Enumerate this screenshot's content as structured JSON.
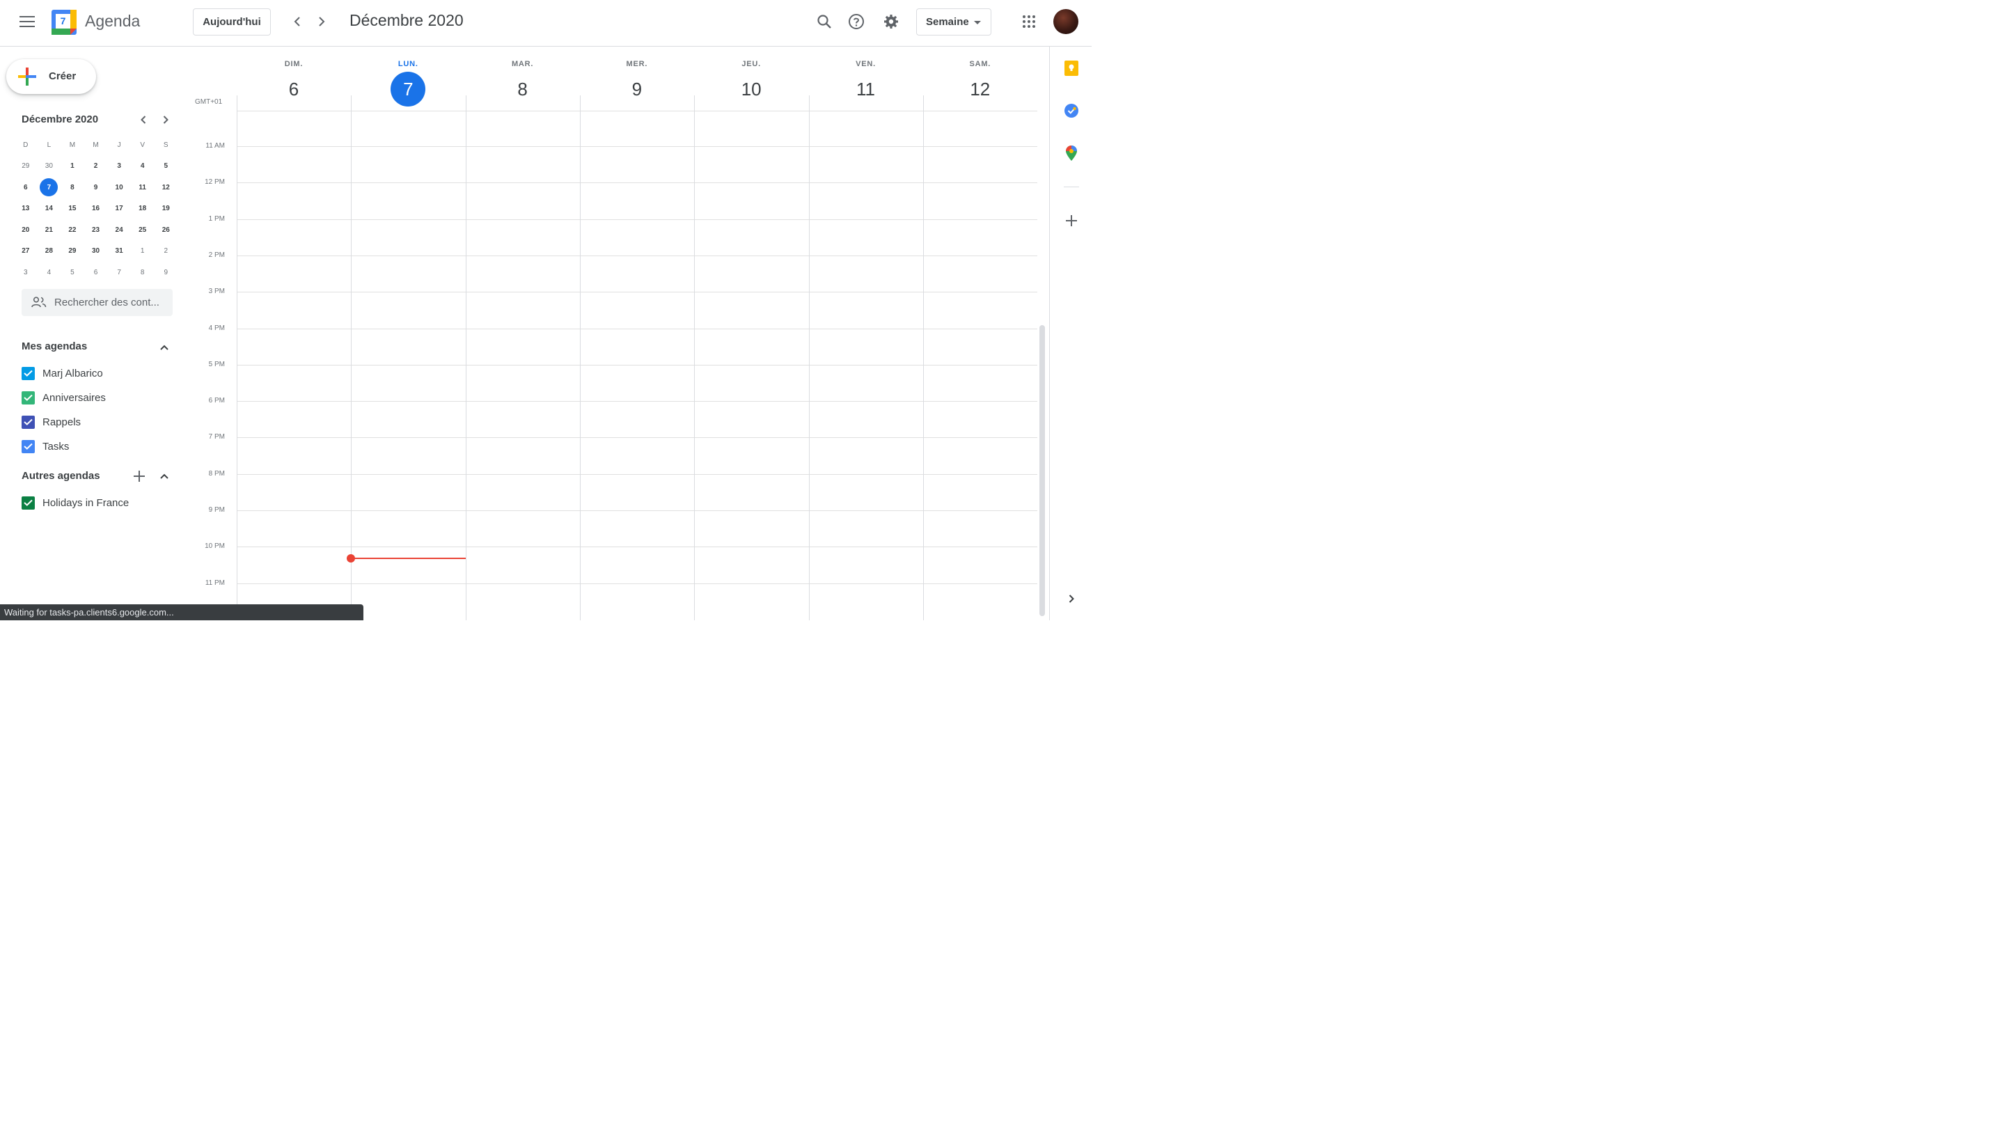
{
  "header": {
    "app_name": "Agenda",
    "logo_day": "7",
    "today_label": "Aujourd'hui",
    "period_title": "Décembre 2020",
    "view_label": "Semaine",
    "icons": [
      "menu-icon",
      "chevron-left-icon",
      "chevron-right-icon",
      "search-icon",
      "help-icon",
      "settings-icon",
      "apps-grid-icon"
    ]
  },
  "sidebar": {
    "create_label": "Créer",
    "mini_calendar": {
      "title": "Décembre 2020",
      "weekday_headers": [
        "D",
        "L",
        "M",
        "M",
        "J",
        "V",
        "S"
      ],
      "weeks": [
        [
          "29",
          "30",
          "1",
          "2",
          "3",
          "4",
          "5"
        ],
        [
          "6",
          "7",
          "8",
          "9",
          "10",
          "11",
          "12"
        ],
        [
          "13",
          "14",
          "15",
          "16",
          "17",
          "18",
          "19"
        ],
        [
          "20",
          "21",
          "22",
          "23",
          "24",
          "25",
          "26"
        ],
        [
          "27",
          "28",
          "29",
          "30",
          "31",
          "1",
          "2"
        ],
        [
          "3",
          "4",
          "5",
          "6",
          "7",
          "8",
          "9"
        ]
      ],
      "selected": "7"
    },
    "search_placeholder": "Rechercher des cont...",
    "my_calendars_title": "Mes agendas",
    "my_calendars": [
      {
        "name": "Marj Albarico",
        "color": "#039be5",
        "checked": true
      },
      {
        "name": "Anniversaires",
        "color": "#33b679",
        "checked": true
      },
      {
        "name": "Rappels",
        "color": "#3f51b5",
        "checked": true
      },
      {
        "name": "Tasks",
        "color": "#4285f4",
        "checked": true
      }
    ],
    "other_calendars_title": "Autres agendas",
    "other_calendars": [
      {
        "name": "Holidays in France",
        "color": "#0b8043",
        "checked": true
      }
    ]
  },
  "week": {
    "timezone": "GMT+01",
    "days": [
      {
        "dow": "DIM.",
        "num": "6",
        "today": false
      },
      {
        "dow": "LUN.",
        "num": "7",
        "today": true
      },
      {
        "dow": "MAR.",
        "num": "8",
        "today": false
      },
      {
        "dow": "MER.",
        "num": "9",
        "today": false
      },
      {
        "dow": "JEU.",
        "num": "10",
        "today": false
      },
      {
        "dow": "VEN.",
        "num": "11",
        "today": false
      },
      {
        "dow": "SAM.",
        "num": "12",
        "today": false
      }
    ],
    "hours": [
      "11 AM",
      "12 PM",
      "1 PM",
      "2 PM",
      "3 PM",
      "4 PM",
      "5 PM",
      "6 PM",
      "7 PM",
      "8 PM",
      "9 PM",
      "10 PM",
      "11 PM"
    ]
  },
  "status_bar": "Waiting for tasks-pa.clients6.google.com..."
}
